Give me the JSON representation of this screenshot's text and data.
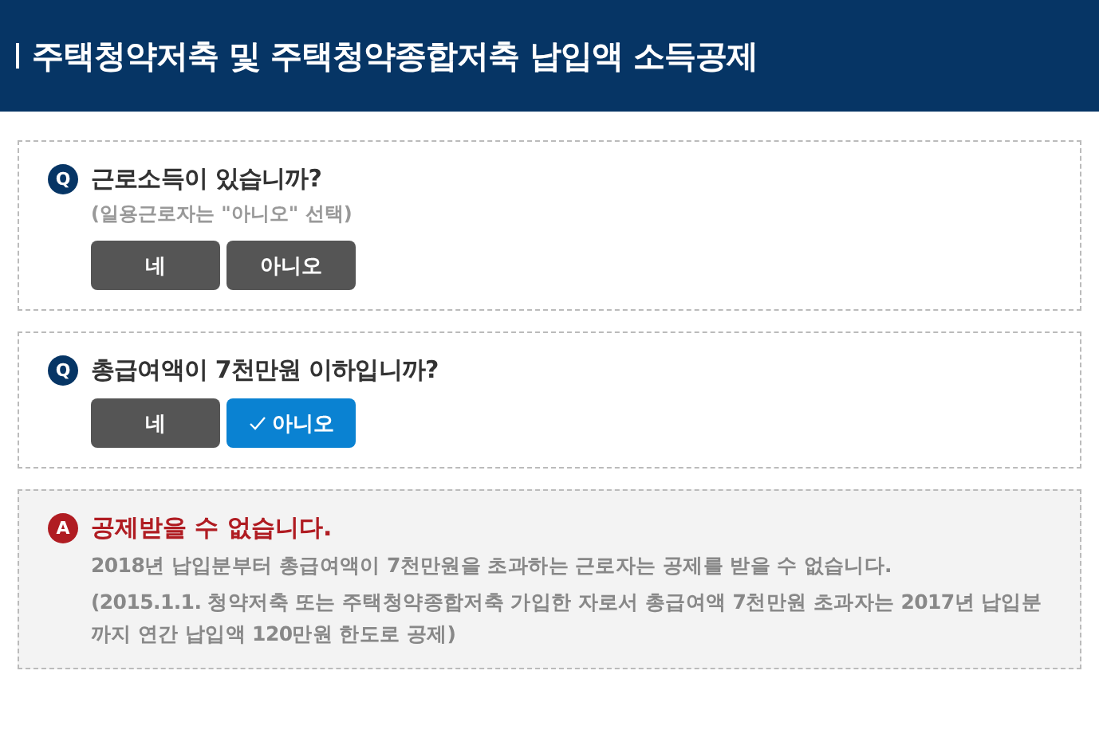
{
  "header": {
    "title": "주택청약저축 및 주택청약종합저축 납입액 소득공제"
  },
  "questions": [
    {
      "badge": "Q",
      "text": "근로소득이 있습니까?",
      "note": "(일용근로자는 \"아니오\" 선택)",
      "options": [
        {
          "label": "네",
          "selected": false
        },
        {
          "label": "아니오",
          "selected": false
        }
      ]
    },
    {
      "badge": "Q",
      "text": "총급여액이 7천만원 이하입니까?",
      "options": [
        {
          "label": "네",
          "selected": false
        },
        {
          "label": "아니오",
          "selected": true
        }
      ]
    }
  ],
  "answer": {
    "badge": "A",
    "title": "공제받을 수 없습니다.",
    "lines": [
      "2018년 납입분부터 총급여액이 7천만원을 초과하는 근로자는 공제를 받을 수 없습니다.",
      "(2015.1.1. 청약저축 또는 주택청약종합저축 가입한 자로서 총급여액 7천만원 초과자는 2017년 납입분까지 연간 납입액 120만원 한도로 공제)"
    ]
  }
}
